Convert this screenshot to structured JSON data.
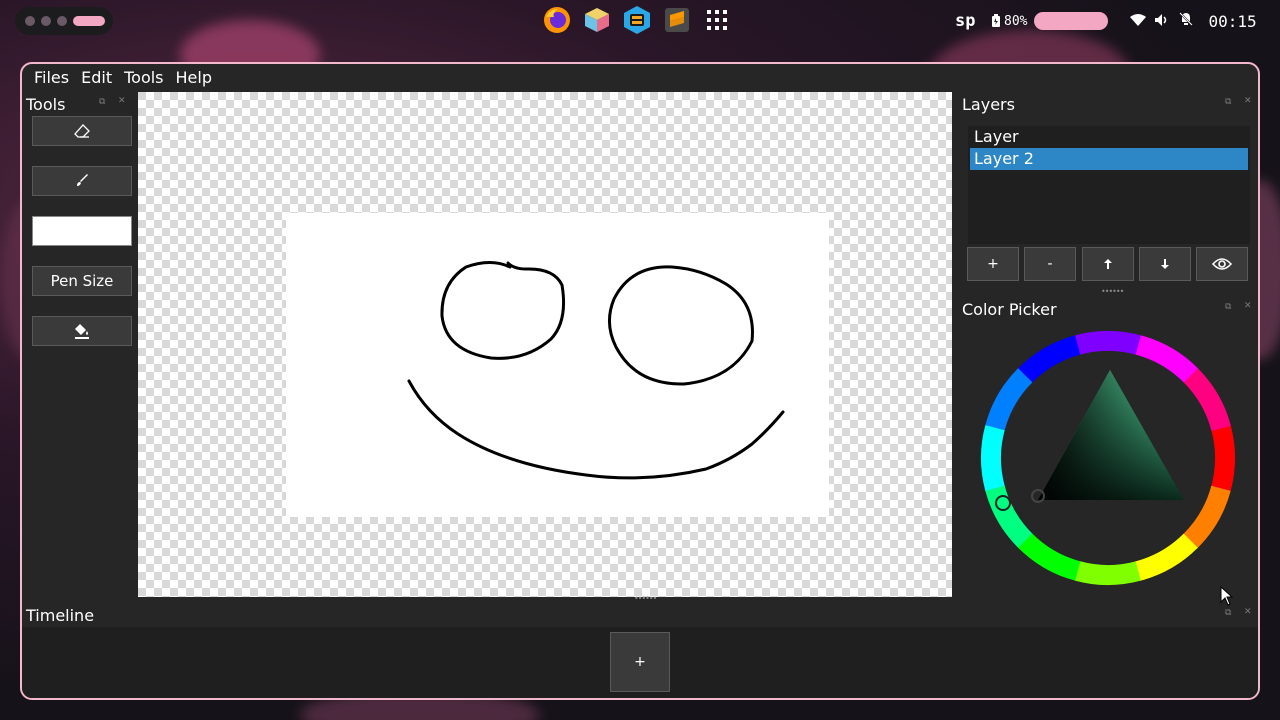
{
  "topbar": {
    "user": "sp",
    "battery": "80%",
    "clock": "00:15",
    "dock_icons": [
      "firefox-icon",
      "cube-app-icon",
      "monitor-app-icon",
      "sublime-text-icon",
      "app-grid-icon"
    ]
  },
  "menu": {
    "files": "Files",
    "edit": "Edit",
    "tools": "Tools",
    "help": "Help"
  },
  "tools_panel": {
    "title": "Tools",
    "eraser_icon": "eraser-icon",
    "brush_icon": "brush-icon",
    "pen_size_label": "Pen Size",
    "fill_icon": "fill-bucket-icon",
    "current_color": "#ffffff"
  },
  "layers_panel": {
    "title": "Layers",
    "layers": [
      {
        "name": "Layer",
        "selected": false
      },
      {
        "name": "Layer 2",
        "selected": true
      }
    ],
    "add_label": "+",
    "remove_label": "-",
    "move_up_icon": "arrow-up-icon",
    "move_down_icon": "arrow-down-icon",
    "visibility_icon": "eye-icon"
  },
  "color_picker": {
    "title": "Color Picker",
    "selected_hue": "#5ef2b0",
    "selected_color": "#000000"
  },
  "timeline": {
    "title": "Timeline",
    "add_frame_label": "+"
  },
  "colors": {
    "accent": "#f4b8cc",
    "selection": "#2d86c6",
    "panel_bg": "#262626"
  }
}
